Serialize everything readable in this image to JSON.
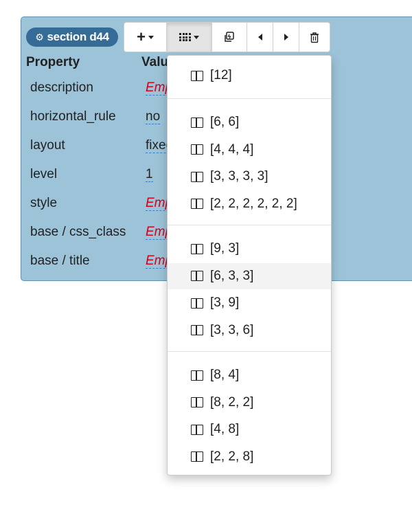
{
  "section": {
    "label": "section d44",
    "icon": "gear-icon"
  },
  "toolbar": {
    "buttons": [
      {
        "name": "add",
        "icon": "plus-icon"
      },
      {
        "name": "layout",
        "icon": "grid-icon"
      },
      {
        "name": "copy",
        "icon": "copy-icon"
      },
      {
        "name": "prev",
        "icon": "caret-left-icon"
      },
      {
        "name": "next",
        "icon": "caret-right-icon"
      },
      {
        "name": "delete",
        "icon": "trash-icon"
      }
    ]
  },
  "table": {
    "header_property": "Property",
    "header_value": "Value",
    "rows": [
      {
        "key": "description",
        "value": "Empty",
        "empty": true
      },
      {
        "key": "horizontal_rule",
        "value": "no",
        "empty": false
      },
      {
        "key": "layout",
        "value": "fixed",
        "empty": false
      },
      {
        "key": "level",
        "value": "1",
        "empty": false
      },
      {
        "key": "style",
        "value": "Empty",
        "empty": true
      },
      {
        "key": "base / css_class",
        "value": "Empty",
        "empty": true
      },
      {
        "key": "base / title",
        "value": "Empty",
        "empty": true
      }
    ]
  },
  "menu": {
    "groups": [
      [
        "[12]"
      ],
      [
        "[6, 6]",
        "[4, 4, 4]",
        "[3, 3, 3, 3]",
        "[2, 2, 2, 2, 2, 2]"
      ],
      [
        "[9, 3]",
        "[6, 3, 3]",
        "[3, 9]",
        "[3, 3, 6]"
      ],
      [
        "[8, 4]",
        "[8, 2, 2]",
        "[4, 8]",
        "[2, 2, 8]"
      ]
    ],
    "hovered": "[6, 3, 3]",
    "item_icon": "columns-icon"
  },
  "colors": {
    "panel": "#9dc3d8",
    "badge": "#346c97",
    "empty_value": "#d0021b"
  }
}
